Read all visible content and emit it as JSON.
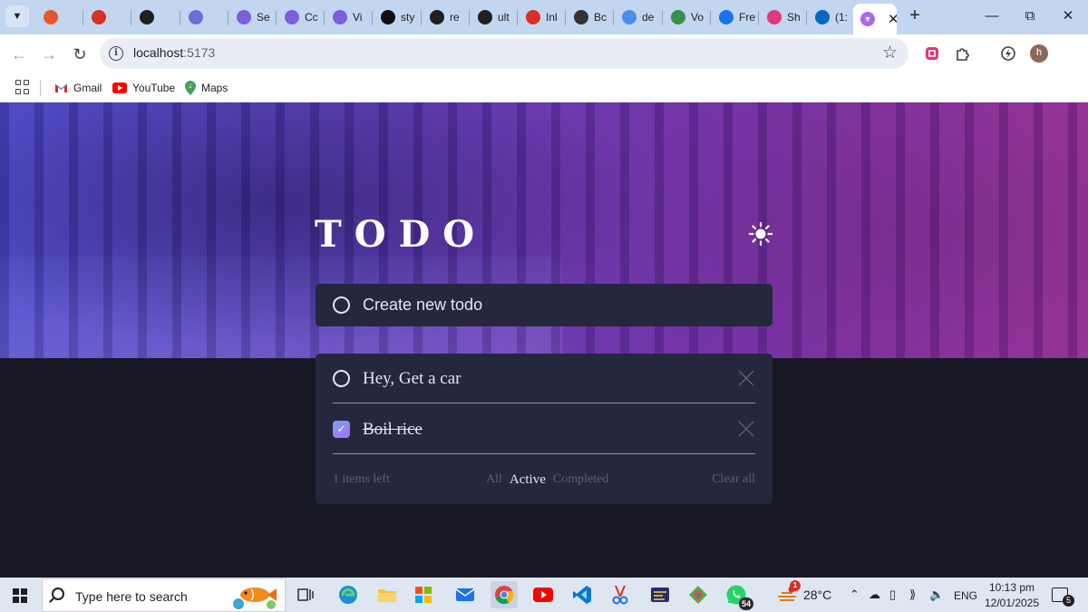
{
  "browser": {
    "tabs": [
      {
        "label": "",
        "color": "#e8572b"
      },
      {
        "label": "",
        "color": "#d93025"
      },
      {
        "label": "",
        "color": "#1f1f1f"
      },
      {
        "label": "",
        "color": "#6b6fd8"
      },
      {
        "label": "Se",
        "color": "#7b5de0"
      },
      {
        "label": "Cc",
        "color": "#7b5de0"
      },
      {
        "label": "Vi",
        "color": "#7b5de0"
      },
      {
        "label": "sty",
        "color": "#111111"
      },
      {
        "label": "re",
        "color": "#1f1f1f"
      },
      {
        "label": "ult",
        "color": "#1f1f1f"
      },
      {
        "label": "Inl",
        "color": "#d93025"
      },
      {
        "label": "Bc",
        "color": "#333333"
      },
      {
        "label": "de",
        "color": "#4a8fe7"
      },
      {
        "label": "Vo",
        "color": "#3b8f4a"
      },
      {
        "label": "Fre",
        "color": "#1a73e8"
      },
      {
        "label": "Sh",
        "color": "#e0377d"
      },
      {
        "label": "(1:",
        "color": "#0a66c2"
      }
    ],
    "active_tab": {
      "label": "",
      "color": "#a66bf2"
    },
    "url_host": "localhost",
    "url_port": ":5173",
    "bookmarks": [
      {
        "label": "Gmail",
        "icon": "gmail-icon"
      },
      {
        "label": "YouTube",
        "icon": "youtube-icon"
      },
      {
        "label": "Maps",
        "icon": "maps-icon"
      }
    ],
    "profile_initial": "h"
  },
  "app": {
    "title": "TODO",
    "theme_icon": "sun-icon",
    "create_placeholder": "Create new todo",
    "todos": [
      {
        "text": "Hey, Get a car",
        "completed": false
      },
      {
        "text": "Boil rice",
        "completed": true
      }
    ],
    "footer": {
      "items_left": "1 items left",
      "filters": [
        "All",
        "Active",
        "Completed"
      ],
      "active_filter": "Active",
      "clear_label": "Clear all"
    },
    "colors": {
      "accent_from": "#7ca4f3",
      "accent_to": "#a56ef2",
      "card": "#25273d",
      "page": "#171823"
    }
  },
  "taskbar": {
    "search_placeholder": "Type here to search",
    "whatsapp_badge": "54",
    "weather_badge": "1",
    "temperature": "28°C",
    "language": "ENG",
    "time": "10:13 pm",
    "date": "12/01/2025",
    "notification_count": "5"
  }
}
